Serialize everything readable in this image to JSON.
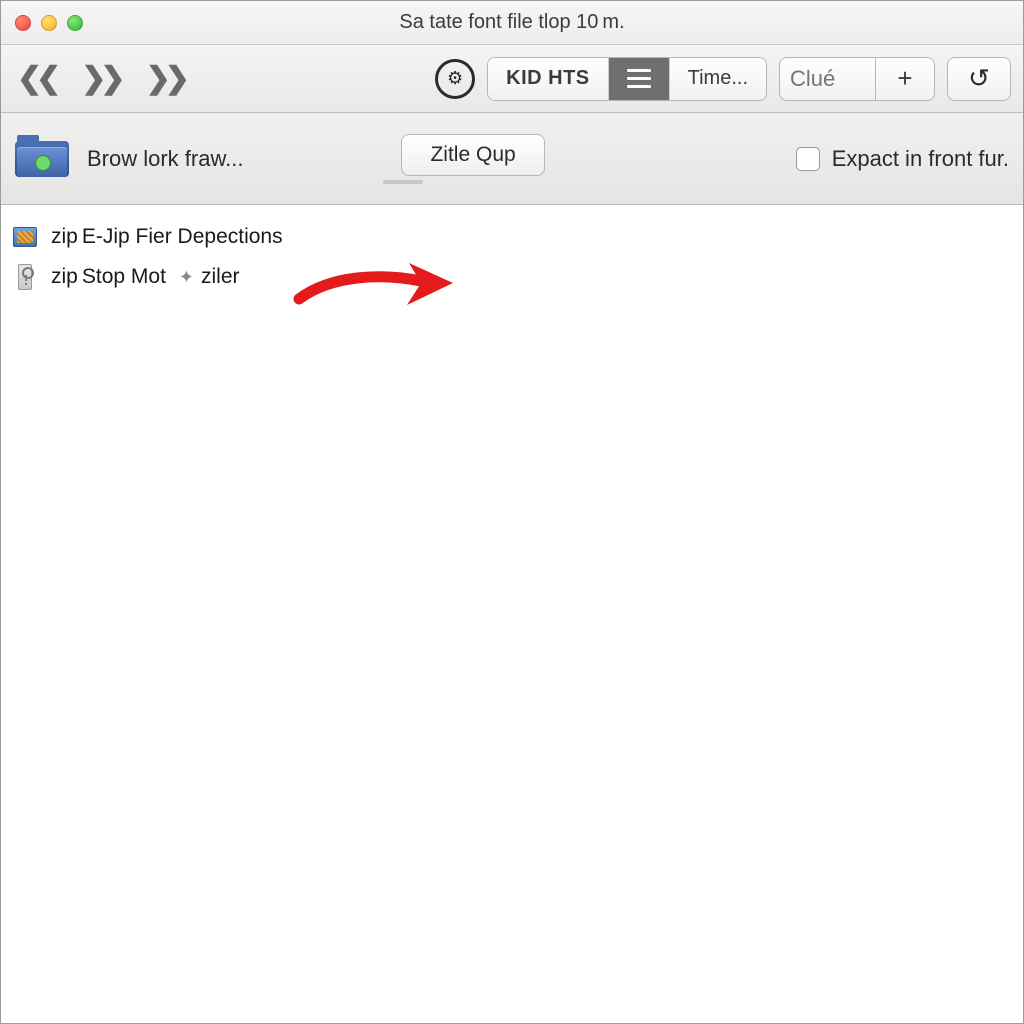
{
  "window": {
    "title": "Sa tate font file tlop 10 m."
  },
  "toolbar": {
    "seg1_label": "KID HTS",
    "seg3_label": "Time...",
    "search_placeholder": "Clué"
  },
  "optbar": {
    "browse_label": "Brow lork fraw...",
    "mid_button": "Zitle Qup",
    "checkbox_label": "Expact in front fur."
  },
  "list": {
    "items": [
      {
        "label_pre": "zip ",
        "label": "E-Jip Fier Depections"
      },
      {
        "label_pre": "zip ",
        "label_a": "Stop Mot",
        "label_b": " ziler"
      }
    ]
  }
}
